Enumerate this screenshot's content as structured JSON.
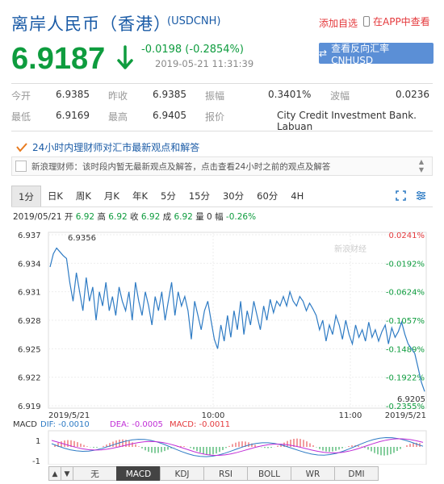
{
  "header": {
    "title": "离岸人民币（香港）",
    "code": "(USDCNH)",
    "add_favorite": "添加自选",
    "view_in_app": "在APP中查看"
  },
  "quote": {
    "price": "6.9187",
    "change": "-0.0198 (-0.2854%)",
    "datetime": "2019-05-21  11:31:39",
    "reverse_button": "查看反向汇率 CNHUSD"
  },
  "stats": {
    "open_label": "今开",
    "open": "6.9385",
    "prev_close_label": "昨收",
    "prev_close": "6.9385",
    "amplitude_label": "振幅",
    "amplitude": "0.3401%",
    "wave_label": "波幅",
    "wave": "0.0236",
    "low_label": "最低",
    "low": "6.9169",
    "high_label": "最高",
    "high": "6.9405",
    "quote_label": "报价",
    "quote_source": "City Credit Investment Bank. Labuan"
  },
  "news": {
    "link": "24小时内理财师对汇市最新观点和解答",
    "message": "新浪理财师：该时段内暂无最新观点及解答，点击查看24小时之前的观点及解答"
  },
  "tabs": [
    "1分",
    "日K",
    "周K",
    "月K",
    "年K",
    "5分",
    "15分",
    "30分",
    "60分",
    "4H"
  ],
  "active_tab": "1分",
  "bar_info": {
    "date": "2019/05/21",
    "open_label": "开",
    "open": "6.92",
    "high_label": "高",
    "high": "6.92",
    "close_label": "收",
    "close": "6.92",
    "last_label": "成",
    "last": "6.92",
    "volume_label": "量",
    "volume": "0",
    "change_label": "幅",
    "change": "-0.26%"
  },
  "chart_data": {
    "type": "line",
    "y_ticks": [
      "6.937",
      "6.934",
      "6.931",
      "6.928",
      "6.925",
      "6.922",
      "6.919"
    ],
    "pct_ticks": [
      "0.0241%",
      "-0.0192%",
      "-0.0624%",
      "-0.1057%",
      "-0.1489%",
      "-0.1922%",
      "-0.2355%"
    ],
    "ylim": [
      6.919,
      6.937
    ],
    "x_labels": [
      "2019/5/21",
      "10:00",
      "11:00",
      "2019/5/21"
    ],
    "max_label": "6.9356",
    "last_label": "6.9205",
    "watermark": "新浪财经",
    "series_color": "#2e7bc4",
    "grid": true
  },
  "macd": {
    "label": "MACD",
    "dif_label": "DIF: -0.0010",
    "dea_label": "DEA: -0.0005",
    "macd_label": "MACD: -0.0011",
    "y_ticks": [
      "1",
      "-1"
    ]
  },
  "indicator_buttons": [
    "无",
    "MACD",
    "KDJ",
    "RSI",
    "BOLL",
    "WR",
    "DMI"
  ],
  "active_indicator": "MACD",
  "colors": {
    "up": "#e4393c",
    "down": "#0e9c3e",
    "link": "#1a5ba6"
  }
}
